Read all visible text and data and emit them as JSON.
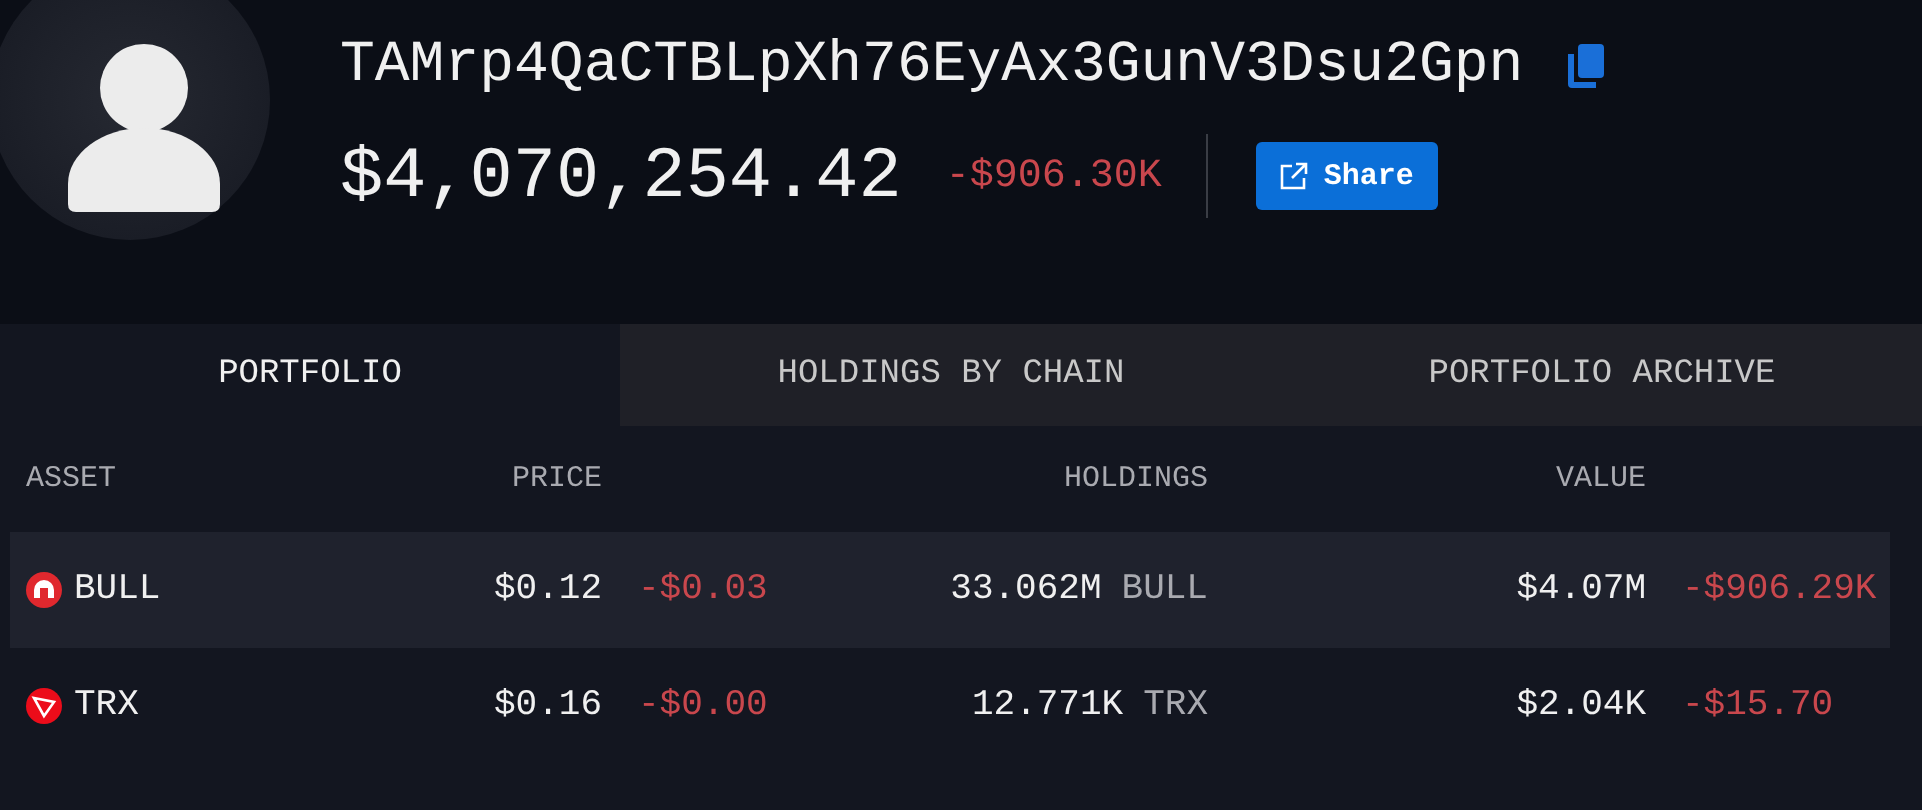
{
  "address": "TAMrp4QaCTBLpXh76EyAx3GunV3Dsu2Gpn",
  "total_value": "$4,070,254.42",
  "total_change": "-$906.30K",
  "share_button": "Share",
  "tabs": [
    {
      "label": "PORTFOLIO",
      "selected": true
    },
    {
      "label": "HOLDINGS BY CHAIN",
      "selected": false
    },
    {
      "label": "PORTFOLIO ARCHIVE",
      "selected": false
    }
  ],
  "table": {
    "columns": [
      "ASSET",
      "PRICE",
      "HOLDINGS",
      "VALUE"
    ],
    "rows": [
      {
        "kind": "bull",
        "asset": "BULL",
        "price": "$0.12",
        "price_change": "-$0.03",
        "holdings": "33.062M",
        "unit": "BULL",
        "value": "$4.07M",
        "value_change": "-$906.29K",
        "selected": true
      },
      {
        "kind": "trx",
        "asset": "TRX",
        "price": "$0.16",
        "price_change": "-$0.00",
        "holdings": "12.771K",
        "unit": "TRX",
        "value": "$2.04K",
        "value_change": "-$15.70",
        "selected": false
      }
    ]
  }
}
